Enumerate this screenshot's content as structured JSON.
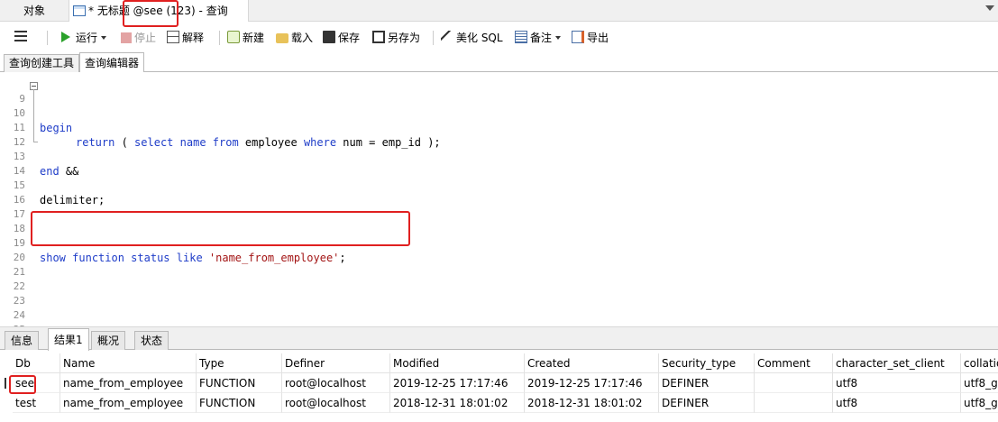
{
  "tabs": {
    "objects_label": "对象",
    "query_label": "* 无标题 @see (123) - 查询"
  },
  "toolbar": {
    "run": "运行",
    "stop": "停止",
    "explain": "解释",
    "new": "新建",
    "load": "载入",
    "save": "保存",
    "save_as": "另存为",
    "beautify": "美化 SQL",
    "notes": "备注",
    "export": "导出"
  },
  "subtabs": {
    "builder": "查询创建工具",
    "editor": "查询编辑器"
  },
  "editor": {
    "lines": [
      {
        "num": "9",
        "text": ""
      },
      {
        "num": "10",
        "text": ""
      },
      {
        "num": "11",
        "text": ""
      },
      {
        "num": "12",
        "text": ""
      },
      {
        "num": "13",
        "text": ""
      },
      {
        "num": "14",
        "text": ""
      },
      {
        "num": "15",
        "text": "delimiter;"
      },
      {
        "num": "16",
        "text": ""
      },
      {
        "num": "17",
        "text": ""
      },
      {
        "num": "18",
        "text": ""
      },
      {
        "num": "19",
        "text": ""
      },
      {
        "num": "20",
        "text": ""
      },
      {
        "num": "21",
        "text": ""
      },
      {
        "num": "22",
        "text": ""
      },
      {
        "num": "23",
        "text": ""
      },
      {
        "num": "24",
        "text": ""
      },
      {
        "num": "25",
        "text": ""
      }
    ],
    "tokens": {
      "begin": "begin",
      "return": "return",
      "open_paren": " ( ",
      "select": "select",
      "name": "name",
      "from": "from",
      "employee": " employee ",
      "where": "where",
      "cond": " num = emp_id );",
      "end": "end",
      "end_rest": " &&",
      "show": "show",
      "function": "function",
      "status": "status",
      "like": "like",
      "literal": "'name_from_employee'",
      "semicolon": ";"
    }
  },
  "bottom_tabs": {
    "info": "信息",
    "result1": "结果1",
    "overview": "概况",
    "status": "状态"
  },
  "result": {
    "columns": [
      "Db",
      "Name",
      "Type",
      "Definer",
      "Modified",
      "Created",
      "Security_type",
      "Comment",
      "character_set_client",
      "collatio"
    ],
    "rows": [
      [
        "see",
        "name_from_employee",
        "FUNCTION",
        "root@localhost",
        "2019-12-25 17:17:46",
        "2019-12-25 17:17:46",
        "DEFINER",
        "",
        "utf8",
        "utf8_ge"
      ],
      [
        "test",
        "name_from_employee",
        "FUNCTION",
        "root@localhost",
        "2018-12-31 18:01:02",
        "2018-12-31 18:01:02",
        "DEFINER",
        "",
        "utf8",
        "utf8_ge"
      ]
    ]
  },
  "colors": {
    "keyword": "#1e3cc8",
    "string": "#a31515",
    "highlight_box": "#e02020",
    "run_icon": "#2aa12a"
  }
}
